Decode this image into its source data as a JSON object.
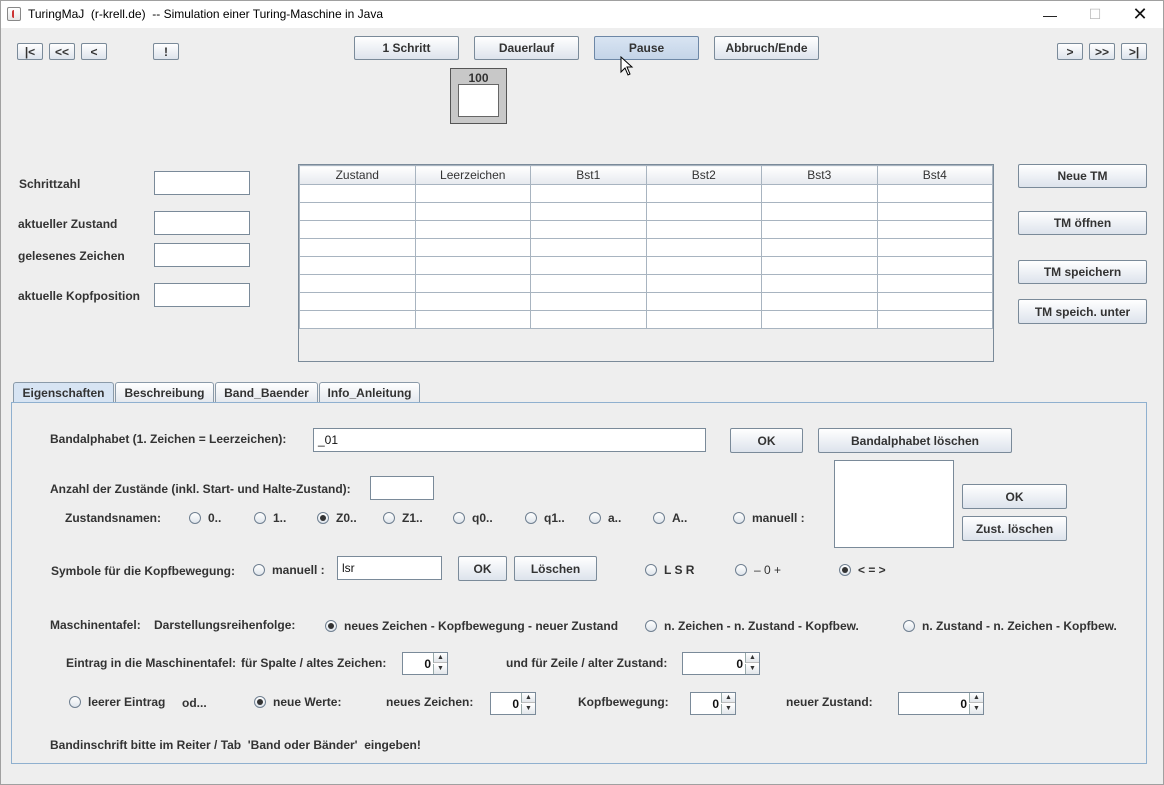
{
  "window": {
    "title": "TuringMaJ  (r-krell.de)  -- Simulation einer Turing-Maschine in Java"
  },
  "nav": {
    "first": "|<",
    "back2": "<<",
    "back": "<",
    "bang": "!",
    "fwd": ">",
    "fwd2": ">>",
    "last": ">|"
  },
  "toolbar": {
    "step": "1 Schritt",
    "continuous": "Dauerlauf",
    "pause": "Pause",
    "abort": "Abbruch/Ende"
  },
  "speed": {
    "value": "100"
  },
  "status": {
    "steps_label": "Schrittzahl",
    "steps_value": "",
    "state_label": "aktueller Zustand",
    "state_value": "",
    "read_label": "gelesenes Zeichen",
    "read_value": "",
    "head_label": "aktuelle Kopfposition",
    "head_value": ""
  },
  "table": {
    "headers": [
      "Zustand",
      "Leerzeichen",
      "Bst1",
      "Bst2",
      "Bst3",
      "Bst4"
    ],
    "row_count": 8
  },
  "side_buttons": {
    "new": "Neue TM",
    "open": "TM öffnen",
    "save": "TM speichern",
    "save_as": "TM speich. unter"
  },
  "tabs": [
    "Eigenschaften",
    "Beschreibung",
    "Band_Baender",
    "Info_Anleitung"
  ],
  "props": {
    "alphabet_label": "Bandalphabet (1. Zeichen = Leerzeichen):",
    "alphabet_value": "_01",
    "ok": "OK",
    "alphabet_clear": "Bandalphabet löschen",
    "states_count_label": "Anzahl der Zustände (inkl. Start- und Halte-Zustand):",
    "states_count_value": "",
    "state_names_label": "Zustandsnamen:",
    "state_names": [
      "0..",
      "1..",
      "Z0..",
      "Z1..",
      "q0..",
      "q1..",
      "a..",
      "A..",
      "manuell :"
    ],
    "state_names_selected": 2,
    "states_ok": "OK",
    "states_clear": "Zust. löschen",
    "head_symbols_label": "Symbole für die Kopfbewegung:",
    "head_manual": "manuell :",
    "head_manual_value": "lsr",
    "head_ok": "OK",
    "head_clear": "Löschen",
    "head_lsr": "L S R",
    "head_minus": "–  0  +",
    "head_arrows": "< = >",
    "table_label": "Maschinentafel:",
    "order_label": "Darstellungsreihenfolge:",
    "order_opt1": "neues Zeichen - Kopfbewegung - neuer Zustand",
    "order_opt2": "n. Zeichen - n. Zustand - Kopfbew.",
    "order_opt3": "n. Zustand - n. Zeichen - Kopfbew.",
    "entry_label": "Eintrag in die Maschinentafel:",
    "col_label": "für Spalte / altes Zeichen:",
    "col_value": "0",
    "row_label": "und für Zeile / alter Zustand:",
    "row_value": "0",
    "empty_entry": "leerer Eintrag",
    "or_label": "od...",
    "new_values": "neue Werte:",
    "new_char_label": "neues Zeichen:",
    "new_char_value": "0",
    "move_label": "Kopfbewegung:",
    "move_value": "0",
    "new_state_label": "neuer Zustand:",
    "new_state_value": "0",
    "hint": "Bandinschrift bitte im Reiter / Tab  'Band oder Bänder'  eingeben!"
  }
}
